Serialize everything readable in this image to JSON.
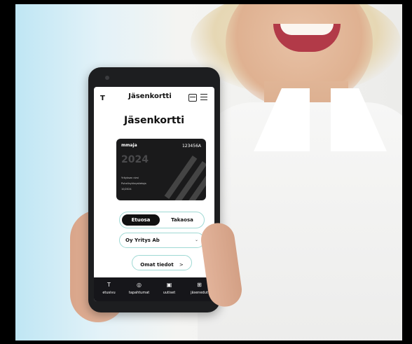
{
  "app": {
    "logo": "T",
    "title": "Jäsenkortti"
  },
  "page": {
    "heading": "Jäsenkortti"
  },
  "card": {
    "brand": "mmaja",
    "member_number": "123456A",
    "year": "2024",
    "lines": [
      "Yrityksen nimi",
      "Puhelinyhteystietoja",
      "10/2024"
    ]
  },
  "toggle": {
    "front_label": "Etuosa",
    "back_label": "Takaosa",
    "selected": "front"
  },
  "company_select": {
    "value": "Oy Yritys Ab",
    "chevron": "⌄"
  },
  "cta": {
    "label": "Omat tiedot",
    "arrow": ">"
  },
  "nav": [
    {
      "label": "etusivu",
      "icon": "logo-icon",
      "glyph": "T"
    },
    {
      "label": "tapahtumat",
      "icon": "calendar-icon",
      "glyph": "◎"
    },
    {
      "label": "uutiset",
      "icon": "news-icon",
      "glyph": "▣"
    },
    {
      "label": "jäsenedut",
      "icon": "gift-icon",
      "glyph": "⊞"
    }
  ],
  "colors": {
    "accent_border": "#9fd9d4",
    "dark": "#16161a",
    "background_tint": "#bfe6f4"
  }
}
